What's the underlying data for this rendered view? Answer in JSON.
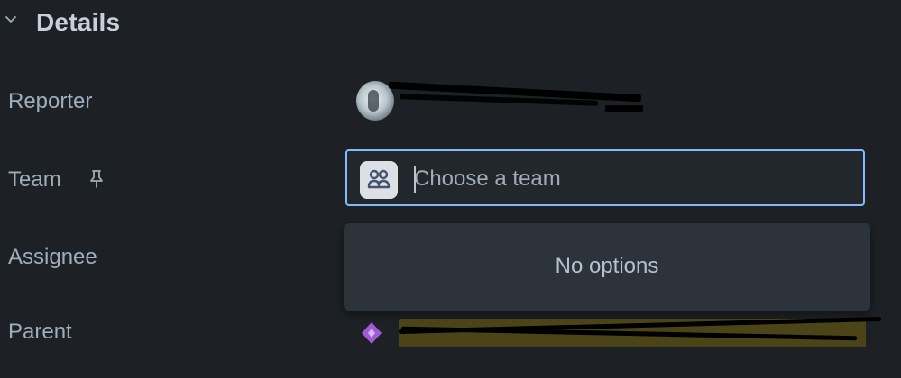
{
  "section": {
    "title": "Details",
    "icon": "chevron-down-icon"
  },
  "fields": {
    "reporter": {
      "label": "Reporter"
    },
    "team": {
      "label": "Team",
      "pin_icon": "pin-icon",
      "placeholder": "Choose a team",
      "value": "",
      "icon": "team-icon"
    },
    "assignee": {
      "label": "Assignee"
    },
    "parent": {
      "label": "Parent",
      "icon": "parent-issue-icon"
    }
  },
  "dropdown": {
    "message": "No options"
  },
  "colors": {
    "background": "#1d2125",
    "focus_border": "#85b8ff",
    "dropdown_bg": "#2c333a",
    "parent_icon": "#9f5bd6"
  }
}
